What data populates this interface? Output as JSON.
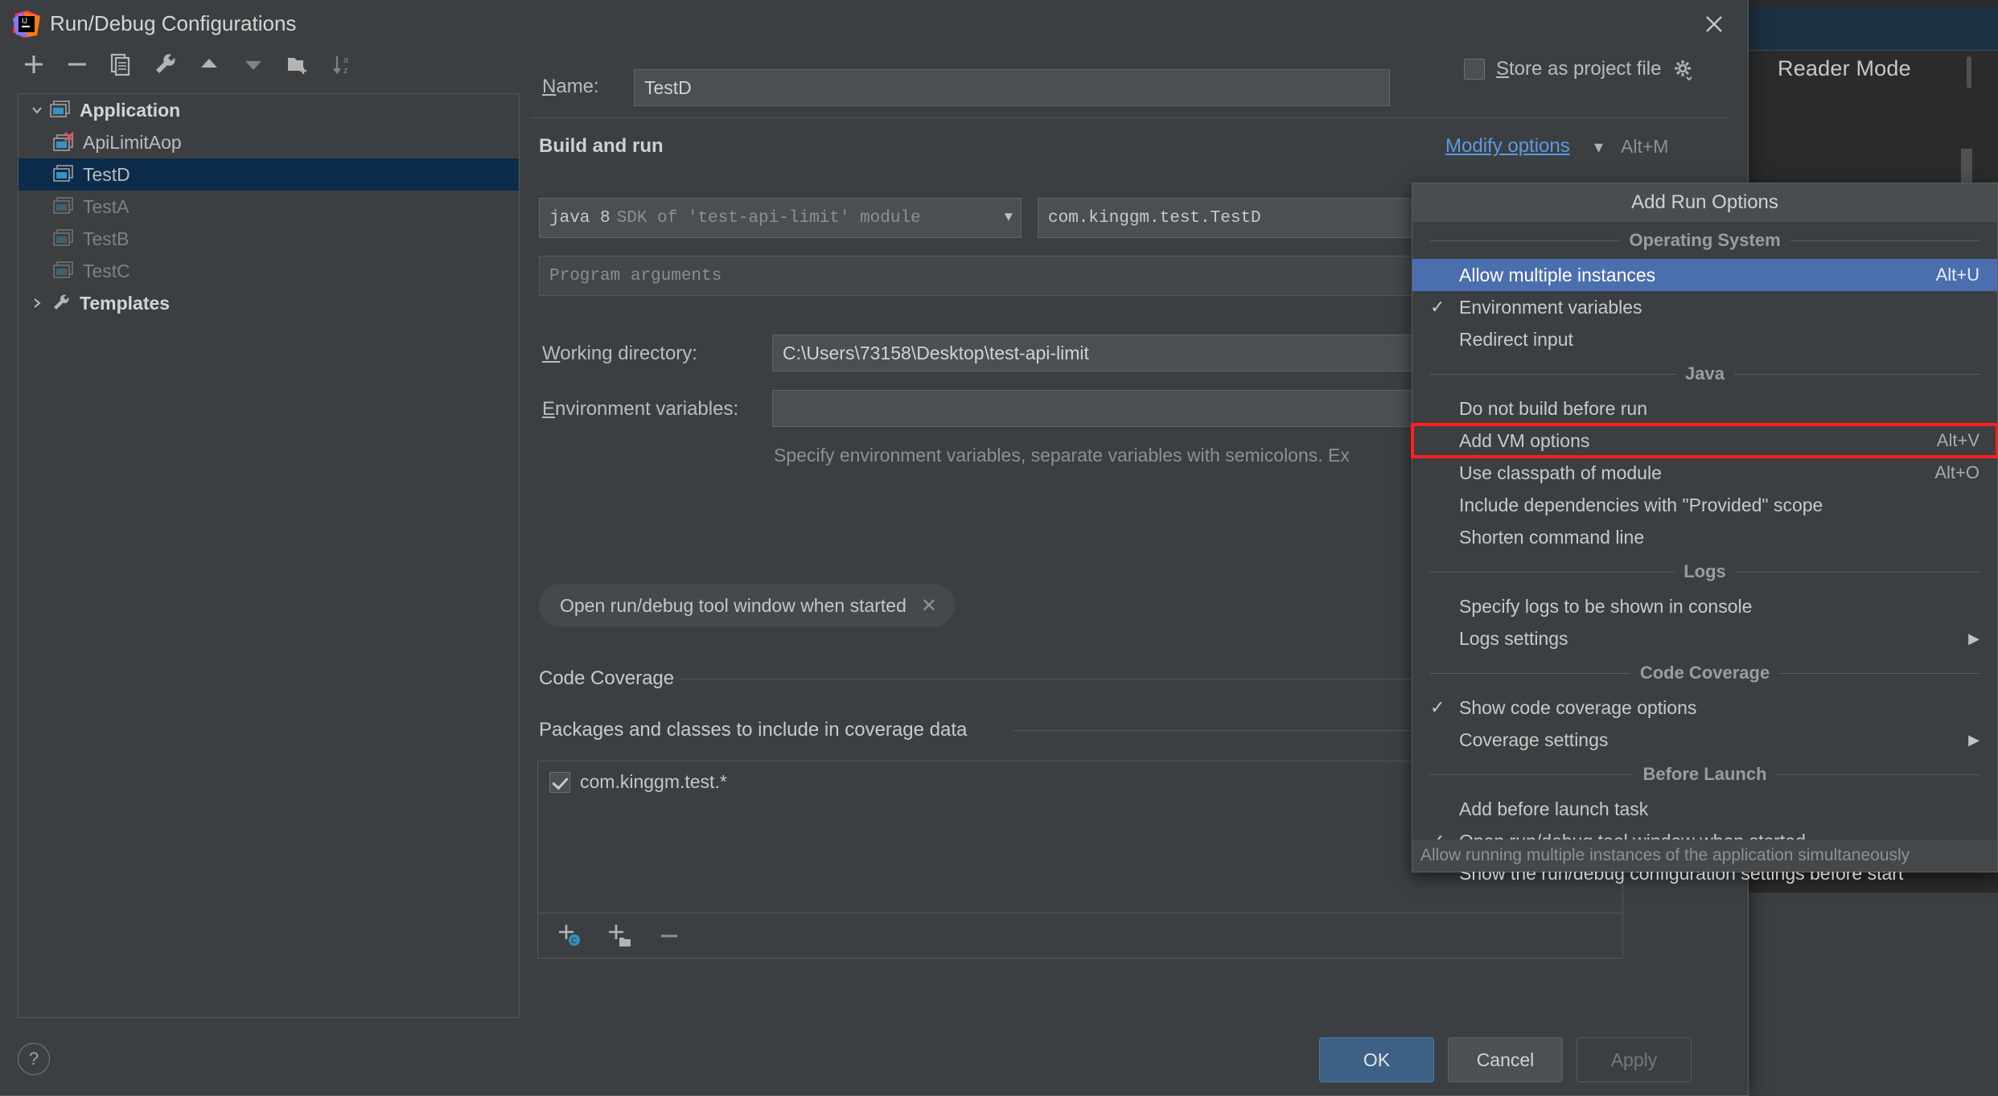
{
  "window": {
    "title": "Run/Debug Configurations",
    "close_icon": "close-icon",
    "logo_icon": "intellij-idea-logo"
  },
  "toolbar": {
    "items": [
      {
        "name": "add-configuration-button",
        "icon": "plus-icon",
        "label": "+"
      },
      {
        "name": "remove-configuration-button",
        "icon": "minus-icon",
        "label": "−"
      },
      {
        "name": "copy-configuration-button",
        "icon": "copy-icon",
        "label": "Copy"
      },
      {
        "name": "edit-templates-button",
        "icon": "wrench-icon",
        "label": "Edit Templates"
      },
      {
        "name": "move-up-button",
        "icon": "triangle-up-icon",
        "label": "Move Up"
      },
      {
        "name": "move-down-button",
        "icon": "triangle-down-icon",
        "label": "Move Down"
      },
      {
        "name": "new-folder-button",
        "icon": "folder-add-icon",
        "label": "New Folder"
      },
      {
        "name": "sort-button",
        "icon": "sort-alphabetical-icon",
        "label": "Sort Configurations"
      }
    ]
  },
  "tree": {
    "nodes": [
      {
        "label": "Application",
        "level": 0,
        "expanded": true,
        "icon": "application-icon",
        "state": "group",
        "selected": false
      },
      {
        "label": "ApiLimitAop",
        "level": 1,
        "icon": "application-error-icon",
        "state": "error",
        "selected": false
      },
      {
        "label": "TestD",
        "level": 1,
        "icon": "application-icon",
        "state": "normal",
        "selected": true
      },
      {
        "label": "TestA",
        "level": 1,
        "icon": "application-icon",
        "state": "dim",
        "selected": false
      },
      {
        "label": "TestB",
        "level": 1,
        "icon": "application-icon",
        "state": "dim",
        "selected": false
      },
      {
        "label": "TestC",
        "level": 1,
        "icon": "application-icon",
        "state": "dim",
        "selected": false
      },
      {
        "label": "Templates",
        "level": 0,
        "expanded": false,
        "icon": "wrench-icon",
        "state": "group",
        "selected": false
      }
    ]
  },
  "form": {
    "name_label": "Name:",
    "name_value": "TestD",
    "store_as_project_file_label": "Store as project file",
    "store_as_project_file_checked": false,
    "store_gear_icon": "gear-icon",
    "build_and_run_title": "Build and run",
    "modify_options_link": "Modify options",
    "modify_options_chevron": "chevron-down-icon",
    "modify_options_shortcut": "Alt+M",
    "sdk_prefix": "java 8",
    "sdk_suffix": "SDK of 'test-api-limit' module",
    "main_class": "com.kinggm.test.TestD",
    "program_arguments_placeholder": "Program arguments",
    "working_directory_label": "Working directory:",
    "working_directory_value": "C:\\Users\\73158\\Desktop\\test-api-limit",
    "environment_variables_label": "Environment variables:",
    "environment_variables_value": "",
    "environment_variables_hint": "Specify environment variables, separate variables with semicolons. Ex",
    "chip_label": "Open run/debug tool window when started",
    "chip_close_icon": "close-icon",
    "code_coverage_title": "Code Coverage",
    "packages_title": "Packages and classes to include in coverage data",
    "coverage_items": [
      {
        "label": "com.kinggm.test.*",
        "checked": true
      }
    ],
    "coverage_toolbar": [
      {
        "name": "add-class-button",
        "icon": "add-class-icon"
      },
      {
        "name": "add-package-button",
        "icon": "add-package-icon"
      },
      {
        "name": "remove-pattern-button",
        "icon": "minus-icon"
      }
    ]
  },
  "buttons": {
    "help": "?",
    "ok": "OK",
    "cancel": "Cancel",
    "apply": "Apply"
  },
  "popup": {
    "header": "Add Run Options",
    "tooltip": "Allow running multiple instances of the application simultaneously",
    "groups": [
      {
        "title": "Operating System",
        "items": [
          {
            "label": "Allow multiple instances",
            "shortcut": "Alt+U",
            "checked": false,
            "selected": true,
            "submenu": false,
            "highlighted": false
          },
          {
            "label": "Environment variables",
            "shortcut": "",
            "checked": true,
            "selected": false,
            "submenu": false,
            "highlighted": false
          },
          {
            "label": "Redirect input",
            "shortcut": "",
            "checked": false,
            "selected": false,
            "submenu": false,
            "highlighted": false
          }
        ]
      },
      {
        "title": "Java",
        "items": [
          {
            "label": "Do not build before run",
            "shortcut": "",
            "checked": false,
            "selected": false,
            "submenu": false,
            "highlighted": false
          },
          {
            "label": "Add VM options",
            "shortcut": "Alt+V",
            "checked": false,
            "selected": false,
            "submenu": false,
            "highlighted": true
          },
          {
            "label": "Use classpath of module",
            "shortcut": "Alt+O",
            "checked": false,
            "selected": false,
            "submenu": false,
            "highlighted": false
          },
          {
            "label": "Include dependencies with \"Provided\" scope",
            "shortcut": "",
            "checked": false,
            "selected": false,
            "submenu": false,
            "highlighted": false
          },
          {
            "label": "Shorten command line",
            "shortcut": "",
            "checked": false,
            "selected": false,
            "submenu": false,
            "highlighted": false
          }
        ]
      },
      {
        "title": "Logs",
        "items": [
          {
            "label": "Specify logs to be shown in console",
            "shortcut": "",
            "checked": false,
            "selected": false,
            "submenu": false,
            "highlighted": false
          },
          {
            "label": "Logs settings",
            "shortcut": "",
            "checked": false,
            "selected": false,
            "submenu": true,
            "highlighted": false
          }
        ]
      },
      {
        "title": "Code Coverage",
        "items": [
          {
            "label": "Show code coverage options",
            "shortcut": "",
            "checked": true,
            "selected": false,
            "submenu": false,
            "highlighted": false
          },
          {
            "label": "Coverage settings",
            "shortcut": "",
            "checked": false,
            "selected": false,
            "submenu": true,
            "highlighted": false
          }
        ]
      },
      {
        "title": "Before Launch",
        "items": [
          {
            "label": "Add before launch task",
            "shortcut": "",
            "checked": false,
            "selected": false,
            "submenu": false,
            "highlighted": false
          },
          {
            "label": "Open run/debug tool window when started",
            "shortcut": "",
            "checked": true,
            "selected": false,
            "submenu": false,
            "highlighted": false
          },
          {
            "label": "Show the run/debug configuration settings before start",
            "shortcut": "",
            "checked": false,
            "selected": false,
            "submenu": false,
            "highlighted": false
          }
        ]
      }
    ]
  },
  "background": {
    "reader_mode_label": "Reader Mode"
  },
  "colors": {
    "dialog_bg": "#3c3f41",
    "selection_blue": "#4b6eaf",
    "tree_selection": "#0d2c4b",
    "link_blue": "#5b9ae6",
    "highlight_red": "#ff1f1f",
    "ok_button": "#3d6185"
  }
}
